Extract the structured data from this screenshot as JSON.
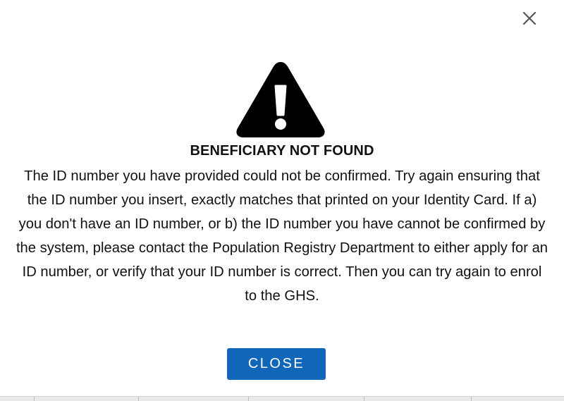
{
  "dialog": {
    "title": "BENEFICIARY NOT FOUND",
    "message": "The ID number you have provided could not be confirmed. Try again ensuring that the ID number you insert, exactly matches that printed on your Identity Card. If a) you don't have an ID number, or b) the ID number you have cannot be confirmed by the system, please contact the Population Registry Department to either apply for an ID number, or verify that your ID number is correct. Then you can try again to enrol to the GHS.",
    "close_button_label": "CLOSE"
  },
  "icons": {
    "dismiss": "close-icon",
    "alert": "warning-icon"
  },
  "colors": {
    "button": "#1166b9",
    "icon": "#000000",
    "dismiss_icon": "#555555"
  }
}
